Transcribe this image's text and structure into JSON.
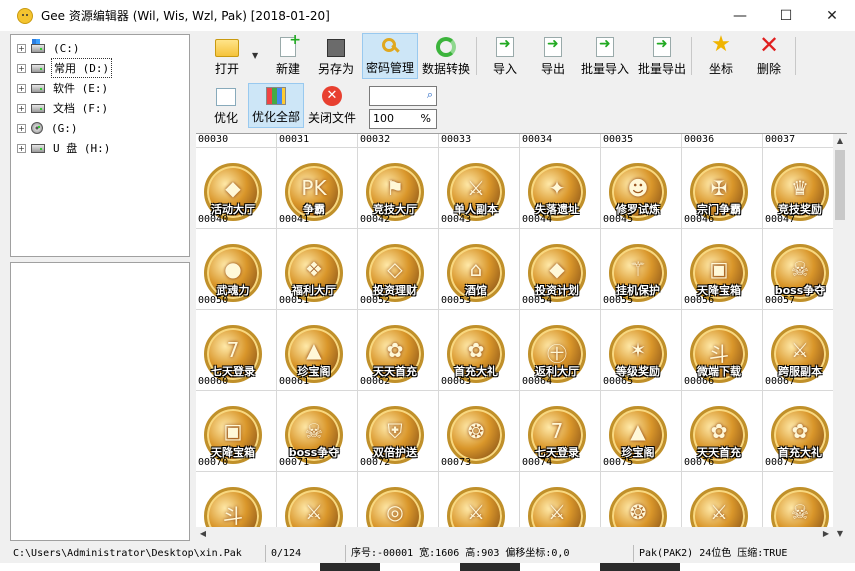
{
  "window": {
    "title": "Gee 资源编辑器 (Wil, Wis, Wzl, Pak) [2018-01-20]",
    "minimize": "—",
    "maximize": "☐",
    "close": "✕"
  },
  "tree": {
    "items": [
      {
        "label": " (C:)",
        "icon": "os-drive-icon"
      },
      {
        "label": "常用 (D:)",
        "icon": "drive-icon",
        "selected": true
      },
      {
        "label": "软件 (E:)",
        "icon": "drive-icon"
      },
      {
        "label": "文档 (F:)",
        "icon": "drive-icon"
      },
      {
        "label": "(G:)",
        "icon": "cd-drive-icon"
      },
      {
        "label": "U 盘 (H:)",
        "icon": "drive-icon"
      }
    ]
  },
  "toolbar": {
    "open": "打开",
    "new": "新建",
    "save_as": "另存为",
    "password": "密码管理",
    "convert": "数据转换",
    "import": "导入",
    "export": "导出",
    "batch_import": "批量导入",
    "batch_export": "批量导出",
    "coords": "坐标",
    "delete": "删除",
    "optimize": "优化",
    "optimize_all": "优化全部",
    "close_file": "关闭文件",
    "search_value": "",
    "zoom_value": "100",
    "zoom_unit": "%"
  },
  "grid": {
    "header_row": [
      "00030",
      "00031",
      "00032",
      "00033",
      "00034",
      "00035",
      "00036",
      "00037"
    ],
    "cells": [
      {
        "idx": "00040",
        "cap": "活动大厅",
        "glyph": "◆"
      },
      {
        "idx": "00041",
        "cap": "争霸",
        "glyph": "PK"
      },
      {
        "idx": "00042",
        "cap": "竞技大厅",
        "glyph": "⚑"
      },
      {
        "idx": "00043",
        "cap": "单人副本",
        "glyph": "⚔"
      },
      {
        "idx": "00044",
        "cap": "失落遗址",
        "glyph": "✦"
      },
      {
        "idx": "00045",
        "cap": "修罗试炼",
        "glyph": "☻"
      },
      {
        "idx": "00046",
        "cap": "宗门争霸",
        "glyph": "✠"
      },
      {
        "idx": "00047",
        "cap": "竞技奖励",
        "glyph": "♛"
      },
      {
        "idx": "00050",
        "cap": "武魂力",
        "glyph": "●"
      },
      {
        "idx": "00051",
        "cap": "福利大厅",
        "glyph": "❖"
      },
      {
        "idx": "00052",
        "cap": "投资理财",
        "glyph": "◇"
      },
      {
        "idx": "00053",
        "cap": "酒馆",
        "glyph": "⌂"
      },
      {
        "idx": "00054",
        "cap": "投资计划",
        "glyph": "◆"
      },
      {
        "idx": "00055",
        "cap": "挂机保护",
        "glyph": "⚚"
      },
      {
        "idx": "00056",
        "cap": "天降宝箱",
        "glyph": "▣"
      },
      {
        "idx": "00057",
        "cap": "boss争夺",
        "glyph": "☠"
      },
      {
        "idx": "00060",
        "cap": "七天登录",
        "glyph": "7"
      },
      {
        "idx": "00061",
        "cap": "珍宝阁",
        "glyph": "▲"
      },
      {
        "idx": "00062",
        "cap": "天天首充",
        "glyph": "✿"
      },
      {
        "idx": "00063",
        "cap": "首充大礼",
        "glyph": "✿"
      },
      {
        "idx": "00064",
        "cap": "返利大厅",
        "glyph": "㊉"
      },
      {
        "idx": "00065",
        "cap": "等级奖励",
        "glyph": "✶"
      },
      {
        "idx": "00066",
        "cap": "微端下载",
        "glyph": "斗"
      },
      {
        "idx": "00067",
        "cap": "跨服副本",
        "glyph": "⚔"
      },
      {
        "idx": "00070",
        "cap": "天降宝箱",
        "glyph": "▣"
      },
      {
        "idx": "00071",
        "cap": "boss争夺",
        "glyph": "☠"
      },
      {
        "idx": "00072",
        "cap": "双倍护送",
        "glyph": "⛨"
      },
      {
        "idx": "00073",
        "cap": "",
        "glyph": "❂"
      },
      {
        "idx": "00074",
        "cap": "七天登录",
        "glyph": "7"
      },
      {
        "idx": "00075",
        "cap": "珍宝阁",
        "glyph": "▲"
      },
      {
        "idx": "00076",
        "cap": "天天首充",
        "glyph": "✿"
      },
      {
        "idx": "00077",
        "cap": "首充大礼",
        "glyph": "✿"
      },
      {
        "idx": "",
        "cap": "",
        "glyph": "斗"
      },
      {
        "idx": "",
        "cap": "",
        "glyph": "⚔"
      },
      {
        "idx": "",
        "cap": "",
        "glyph": "◎"
      },
      {
        "idx": "",
        "cap": "",
        "glyph": "⚔"
      },
      {
        "idx": "",
        "cap": "",
        "glyph": "⚔"
      },
      {
        "idx": "",
        "cap": "",
        "glyph": "❂"
      },
      {
        "idx": "",
        "cap": "",
        "glyph": "⚔"
      },
      {
        "idx": "",
        "cap": "",
        "glyph": "☠"
      }
    ]
  },
  "status": {
    "path": "C:\\Users\\Administrator\\Desktop\\xin.Pak",
    "count": "0/124",
    "info": "序号:-00001 宽:1606 高:903 偏移坐标:0,0",
    "format": "Pak(PAK2) 24位色 压缩:TRUE"
  }
}
